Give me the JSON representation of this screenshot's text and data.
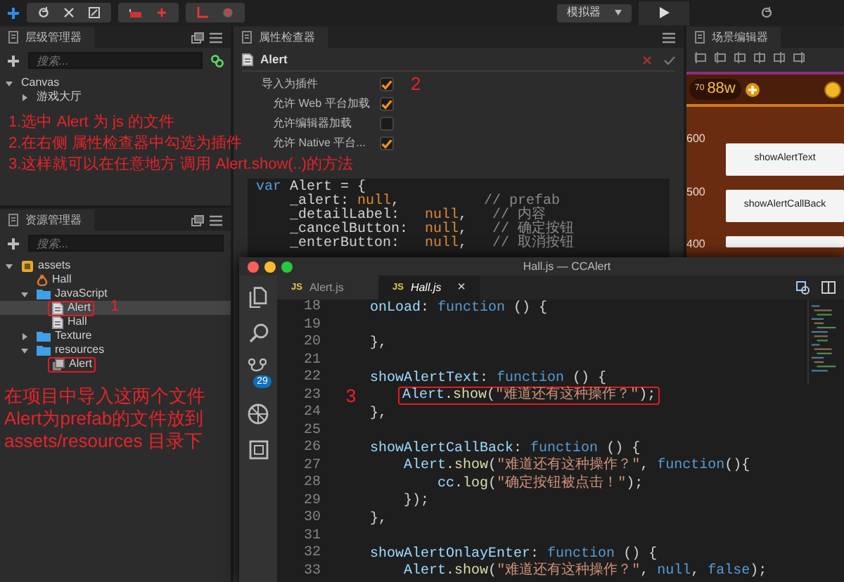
{
  "toolbar": {
    "simulator": "模拟器"
  },
  "hierarchy": {
    "title": "层级管理器",
    "search": {
      "placeholder": "搜索..."
    },
    "tree": [
      {
        "label": "Canvas",
        "expanded": true,
        "selected": false,
        "children": [
          {
            "label": "游戏大厅",
            "expanded": false,
            "selected": false
          }
        ]
      }
    ]
  },
  "instructions": [
    "1.选中 Alert 为 js 的文件",
    "2.在右侧 属性检查器中勾选为插件",
    "3.这样就可以在任意地方 调用 Alert.show(..)的方法"
  ],
  "inspector": {
    "title": "属性检查器",
    "asset": "Alert",
    "marker": "2",
    "properties": [
      {
        "label": "导入为插件",
        "checked": true,
        "children": [
          {
            "label": "允许 Web 平台加载",
            "checked": true
          },
          {
            "label": "允许编辑器加载",
            "checked": false
          },
          {
            "label": "允许 Native 平台...",
            "checked": true
          }
        ]
      }
    ],
    "preview": [
      {
        "tokens": [
          {
            "text": "var",
            "kind": "keyword"
          },
          {
            "text": " Alert = {",
            "kind": "plain"
          }
        ],
        "children": [
          {
            "tokens": [
              {
                "text": "_alert: ",
                "kind": "plain"
              },
              {
                "text": "null",
                "kind": "literal"
              },
              {
                "text": ",          ",
                "kind": "plain"
              },
              {
                "text": "// prefab",
                "kind": "comment"
              }
            ]
          },
          {
            "tokens": [
              {
                "text": "_detailLabel:   ",
                "kind": "plain"
              },
              {
                "text": "null",
                "kind": "literal"
              },
              {
                "text": ",   ",
                "kind": "plain"
              },
              {
                "text": "// 内容",
                "kind": "comment"
              }
            ]
          },
          {
            "tokens": [
              {
                "text": "_cancelButton:  ",
                "kind": "plain"
              },
              {
                "text": "null",
                "kind": "literal"
              },
              {
                "text": ",   ",
                "kind": "plain"
              },
              {
                "text": "// 确定按钮",
                "kind": "comment"
              }
            ]
          },
          {
            "tokens": [
              {
                "text": "_enterButton:   ",
                "kind": "plain"
              },
              {
                "text": "null",
                "kind": "literal"
              },
              {
                "text": ",   ",
                "kind": "plain"
              },
              {
                "text": "// 取消按钮",
                "kind": "comment"
              }
            ]
          }
        ]
      }
    ]
  },
  "assets": {
    "title": "资源管理器",
    "search": {
      "placeholder": "搜索..."
    },
    "tree": [
      {
        "label": "assets",
        "kind": "database",
        "expanded": true,
        "selected": false,
        "outlined": false,
        "children": [
          {
            "label": "Hall",
            "kind": "scene",
            "selected": false,
            "outlined": false
          },
          {
            "label": "JavaScript",
            "kind": "folder",
            "expanded": true,
            "selected": false,
            "outlined": false,
            "children": [
              {
                "label": "Alert",
                "kind": "script",
                "selected": true,
                "outlined": true,
                "marker": "1"
              },
              {
                "label": "Hall",
                "kind": "script",
                "selected": false,
                "outlined": false
              }
            ]
          },
          {
            "label": "Texture",
            "kind": "folder",
            "expanded": false,
            "selected": false,
            "outlined": false
          },
          {
            "label": "resources",
            "kind": "folder",
            "expanded": true,
            "selected": false,
            "outlined": false,
            "children": [
              {
                "label": "Alert",
                "kind": "prefab",
                "selected": false,
                "outlined": true
              }
            ]
          }
        ]
      }
    ],
    "note": [
      "在项目中导入这两个文件",
      "Alert为prefab的文件放到",
      "assets/resources 目录下"
    ]
  },
  "scene": {
    "title": "场景编辑器",
    "coins": "70",
    "gold": "88w",
    "ruler": [
      "600",
      "500",
      "400"
    ],
    "buttons": [
      "showAlertText",
      "showAlertCallBack"
    ]
  },
  "editor": {
    "title": "Hall.js — CCAlert",
    "badge": "29",
    "tabs": [
      {
        "label": "Alert.js",
        "type": "JS",
        "selected": false,
        "preview": false
      },
      {
        "label": "Hall.js",
        "type": "JS",
        "selected": true,
        "preview": true,
        "close": "×"
      }
    ],
    "lines": [
      {
        "num": "18",
        "tokens": [
          {
            "text": "onLoad",
            "kind": "property"
          },
          {
            "text": ": ",
            "kind": "plain"
          },
          {
            "text": "function",
            "kind": "keyword"
          },
          {
            "text": " () {",
            "kind": "plain"
          }
        ]
      },
      {
        "num": "19"
      },
      {
        "num": "20",
        "tokens": [
          {
            "text": "},",
            "kind": "plain"
          }
        ]
      },
      {
        "num": "21"
      },
      {
        "num": "22",
        "tokens": [
          {
            "text": "showAlertText",
            "kind": "property"
          },
          {
            "text": ": ",
            "kind": "plain"
          },
          {
            "text": "function",
            "kind": "keyword"
          },
          {
            "text": " () {",
            "kind": "plain"
          }
        ],
        "children": [
          {
            "num": "23",
            "marker": "3",
            "outlined": true,
            "tokens": [
              {
                "text": "Alert",
                "kind": "property"
              },
              {
                "text": ".",
                "kind": "plain"
              },
              {
                "text": "show",
                "kind": "function"
              },
              {
                "text": "(",
                "kind": "plain"
              },
              {
                "text": "\"难道还有这种操作？\"",
                "kind": "string"
              },
              {
                "text": ");",
                "kind": "plain"
              }
            ]
          }
        ]
      },
      {
        "num": "24",
        "tokens": [
          {
            "text": "},",
            "kind": "plain"
          }
        ]
      },
      {
        "num": "25"
      },
      {
        "num": "26",
        "tokens": [
          {
            "text": "showAlertCallBack",
            "kind": "property"
          },
          {
            "text": ": ",
            "kind": "plain"
          },
          {
            "text": "function",
            "kind": "keyword"
          },
          {
            "text": " () {",
            "kind": "plain"
          }
        ],
        "children": [
          {
            "num": "27",
            "tokens": [
              {
                "text": "Alert",
                "kind": "property"
              },
              {
                "text": ".",
                "kind": "plain"
              },
              {
                "text": "show",
                "kind": "function"
              },
              {
                "text": "(",
                "kind": "plain"
              },
              {
                "text": "\"难道还有这种操作？\"",
                "kind": "string"
              },
              {
                "text": ", ",
                "kind": "plain"
              },
              {
                "text": "function",
                "kind": "keyword"
              },
              {
                "text": "(){",
                "kind": "plain"
              }
            ],
            "children": [
              {
                "num": "28",
                "tokens": [
                  {
                    "text": "cc",
                    "kind": "property"
                  },
                  {
                    "text": ".",
                    "kind": "plain"
                  },
                  {
                    "text": "log",
                    "kind": "function"
                  },
                  {
                    "text": "(",
                    "kind": "plain"
                  },
                  {
                    "text": "\"确定按钮被点击！\"",
                    "kind": "string"
                  },
                  {
                    "text": ");",
                    "kind": "plain"
                  }
                ]
              }
            ]
          },
          {
            "num": "29",
            "tokens": [
              {
                "text": "});",
                "kind": "plain"
              }
            ]
          }
        ]
      },
      {
        "num": "30",
        "tokens": [
          {
            "text": "},",
            "kind": "plain"
          }
        ]
      },
      {
        "num": "31"
      },
      {
        "num": "32",
        "tokens": [
          {
            "text": "showAlertOnlayEnter",
            "kind": "property"
          },
          {
            "text": ": ",
            "kind": "plain"
          },
          {
            "text": "function",
            "kind": "keyword"
          },
          {
            "text": " () {",
            "kind": "plain"
          }
        ],
        "children": [
          {
            "num": "33",
            "tokens": [
              {
                "text": "Alert",
                "kind": "property"
              },
              {
                "text": ".",
                "kind": "plain"
              },
              {
                "text": "show",
                "kind": "function"
              },
              {
                "text": "(",
                "kind": "plain"
              },
              {
                "text": "\"难道还有这种操作？\"",
                "kind": "string"
              },
              {
                "text": ", ",
                "kind": "plain"
              },
              {
                "text": "null",
                "kind": "keyword"
              },
              {
                "text": ", ",
                "kind": "plain"
              },
              {
                "text": "false",
                "kind": "keyword"
              },
              {
                "text": ");",
                "kind": "plain"
              }
            ]
          }
        ]
      }
    ]
  }
}
